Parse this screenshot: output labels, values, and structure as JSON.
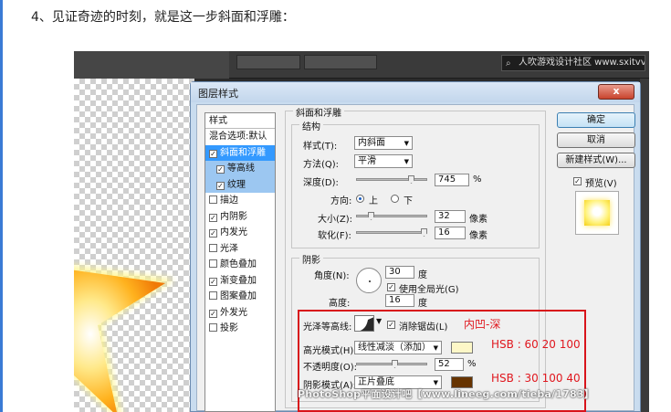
{
  "page": {
    "heading": "4、见证奇迹的时刻，就是这一步斜面和浮雕："
  },
  "photoshop": {
    "search_text": "人吹游戏设计社区 www.sxitvv.nnn"
  },
  "dialog": {
    "title": "图层样式",
    "close_label": "x",
    "styles_header": "样式",
    "blend_options": "混合选项:默认",
    "style_items": [
      {
        "label": "斜面和浮雕",
        "checked": true,
        "state": "selected"
      },
      {
        "label": "等高线",
        "checked": true,
        "state": "sub"
      },
      {
        "label": "纹理",
        "checked": true,
        "state": "sub"
      },
      {
        "label": "描边",
        "checked": false,
        "state": "normal"
      },
      {
        "label": "内阴影",
        "checked": true,
        "state": "normal"
      },
      {
        "label": "内发光",
        "checked": true,
        "state": "normal"
      },
      {
        "label": "光泽",
        "checked": false,
        "state": "normal"
      },
      {
        "label": "颜色叠加",
        "checked": false,
        "state": "normal"
      },
      {
        "label": "渐变叠加",
        "checked": true,
        "state": "normal"
      },
      {
        "label": "图案叠加",
        "checked": false,
        "state": "normal"
      },
      {
        "label": "外发光",
        "checked": true,
        "state": "normal"
      },
      {
        "label": "投影",
        "checked": false,
        "state": "normal"
      }
    ],
    "bevel": {
      "group_title": "斜面和浮雕",
      "structure_title": "结构",
      "style_label": "样式(T):",
      "style_value": "内斜面",
      "method_label": "方法(Q):",
      "method_value": "平滑",
      "depth_label": "深度(D):",
      "depth_value": "745",
      "depth_unit": "%",
      "direction_label": "方向:",
      "direction_up": "上",
      "direction_down": "下",
      "size_label": "大小(Z):",
      "size_value": "32",
      "size_unit": "像素",
      "soften_label": "软化(F):",
      "soften_value": "16",
      "soften_unit": "像素"
    },
    "shading": {
      "group_title": "阴影",
      "angle_label": "角度(N):",
      "angle_value": "30",
      "angle_unit": "度",
      "global_light_label": "使用全局光(G)",
      "altitude_label": "高度:",
      "altitude_value": "16",
      "altitude_unit": "度",
      "gloss_contour_label": "光泽等高线:",
      "anti_alias_label": "消除锯齿(L)",
      "highlight_mode_label": "高光模式(H):",
      "highlight_mode_value": "线性减淡（添加）",
      "highlight_opacity_label": "不透明度(O):",
      "highlight_opacity_value": "52",
      "highlight_opacity_unit": "%",
      "shadow_mode_label": "阴影模式(A):",
      "shadow_mode_value": "正片叠底"
    },
    "buttons": {
      "ok": "确定",
      "cancel": "取消",
      "new_style": "新建样式(W)...",
      "preview": "预览(V)"
    }
  },
  "colors": {
    "highlight_color": "#fdf7c7",
    "shadow_color": "#663300"
  },
  "annotations": {
    "contour_note": "内凹-深",
    "highlight_hsb": "HSB : 60 20 100",
    "shadow_hsb": "HSB : 30 100 40"
  },
  "watermark": "PhotoShop平面设计吧【www.lineeg.com/tieba/1783】"
}
